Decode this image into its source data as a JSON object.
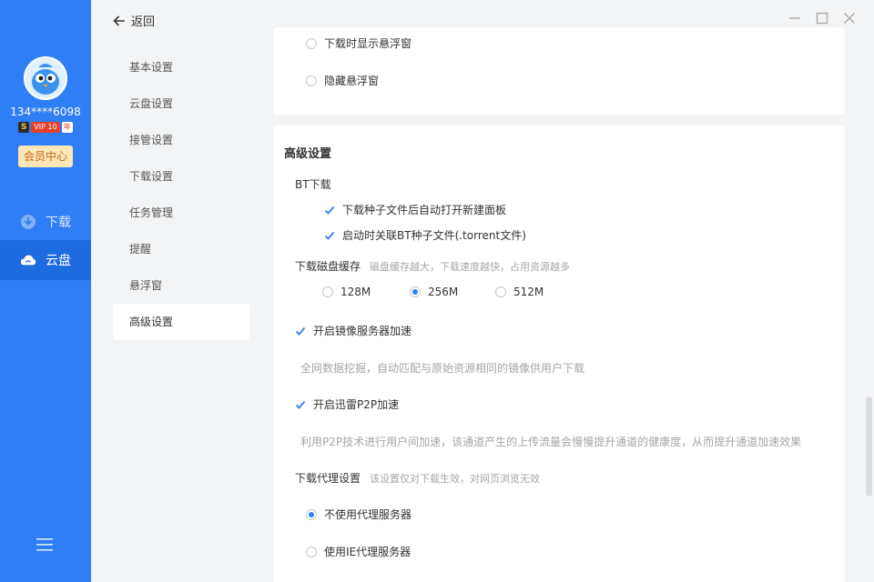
{
  "user": {
    "name": "134****6098",
    "vip_s": "S",
    "vip_label": "VIP 10",
    "vip_year": "年",
    "member_center": "会员中心"
  },
  "main_nav": [
    {
      "label": "下载",
      "icon": "download-icon"
    },
    {
      "label": "云盘",
      "icon": "cloud-icon",
      "active": true
    }
  ],
  "topbar": {
    "back_label": "返回"
  },
  "settings_nav": [
    {
      "label": "基本设置"
    },
    {
      "label": "云盘设置"
    },
    {
      "label": "接管设置"
    },
    {
      "label": "下载设置"
    },
    {
      "label": "任务管理"
    },
    {
      "label": "提醒"
    },
    {
      "label": "悬浮窗"
    },
    {
      "label": "高级设置",
      "active": true
    }
  ],
  "floating": {
    "show_on_download": "下载时显示悬浮窗",
    "hide": "隐藏悬浮窗"
  },
  "advanced": {
    "title": "高级设置",
    "bt": {
      "heading": "BT下载",
      "auto_open": "下载种子文件后自动打开新建面板",
      "associate": "启动时关联BT种子文件(.torrent文件)"
    },
    "cache": {
      "heading": "下载磁盘缓存",
      "hint": "磁盘缓存越大，下载速度越快，占用资源越多",
      "options": [
        "128M",
        "256M",
        "512M"
      ],
      "selected": "256M"
    },
    "mirror": {
      "label": "开启镜像服务器加速",
      "desc": "全网数据挖掘，自动匹配与原始资源相同的镜像供用户下载"
    },
    "p2p": {
      "label": "开启迅雷P2P加速",
      "desc": "利用P2P技术进行用户间加速，该通道产生的上传流量会慢慢提升通道的健康度，从而提升通道加速效果"
    },
    "proxy": {
      "heading": "下载代理设置",
      "hint": "该设置仅对下载生效，对网页浏览无效",
      "no_proxy": "不使用代理服务器",
      "ie_proxy": "使用IE代理服务器"
    }
  },
  "colors": {
    "accent": "#2e7ff5",
    "sidebar": "#2e7ff5"
  }
}
